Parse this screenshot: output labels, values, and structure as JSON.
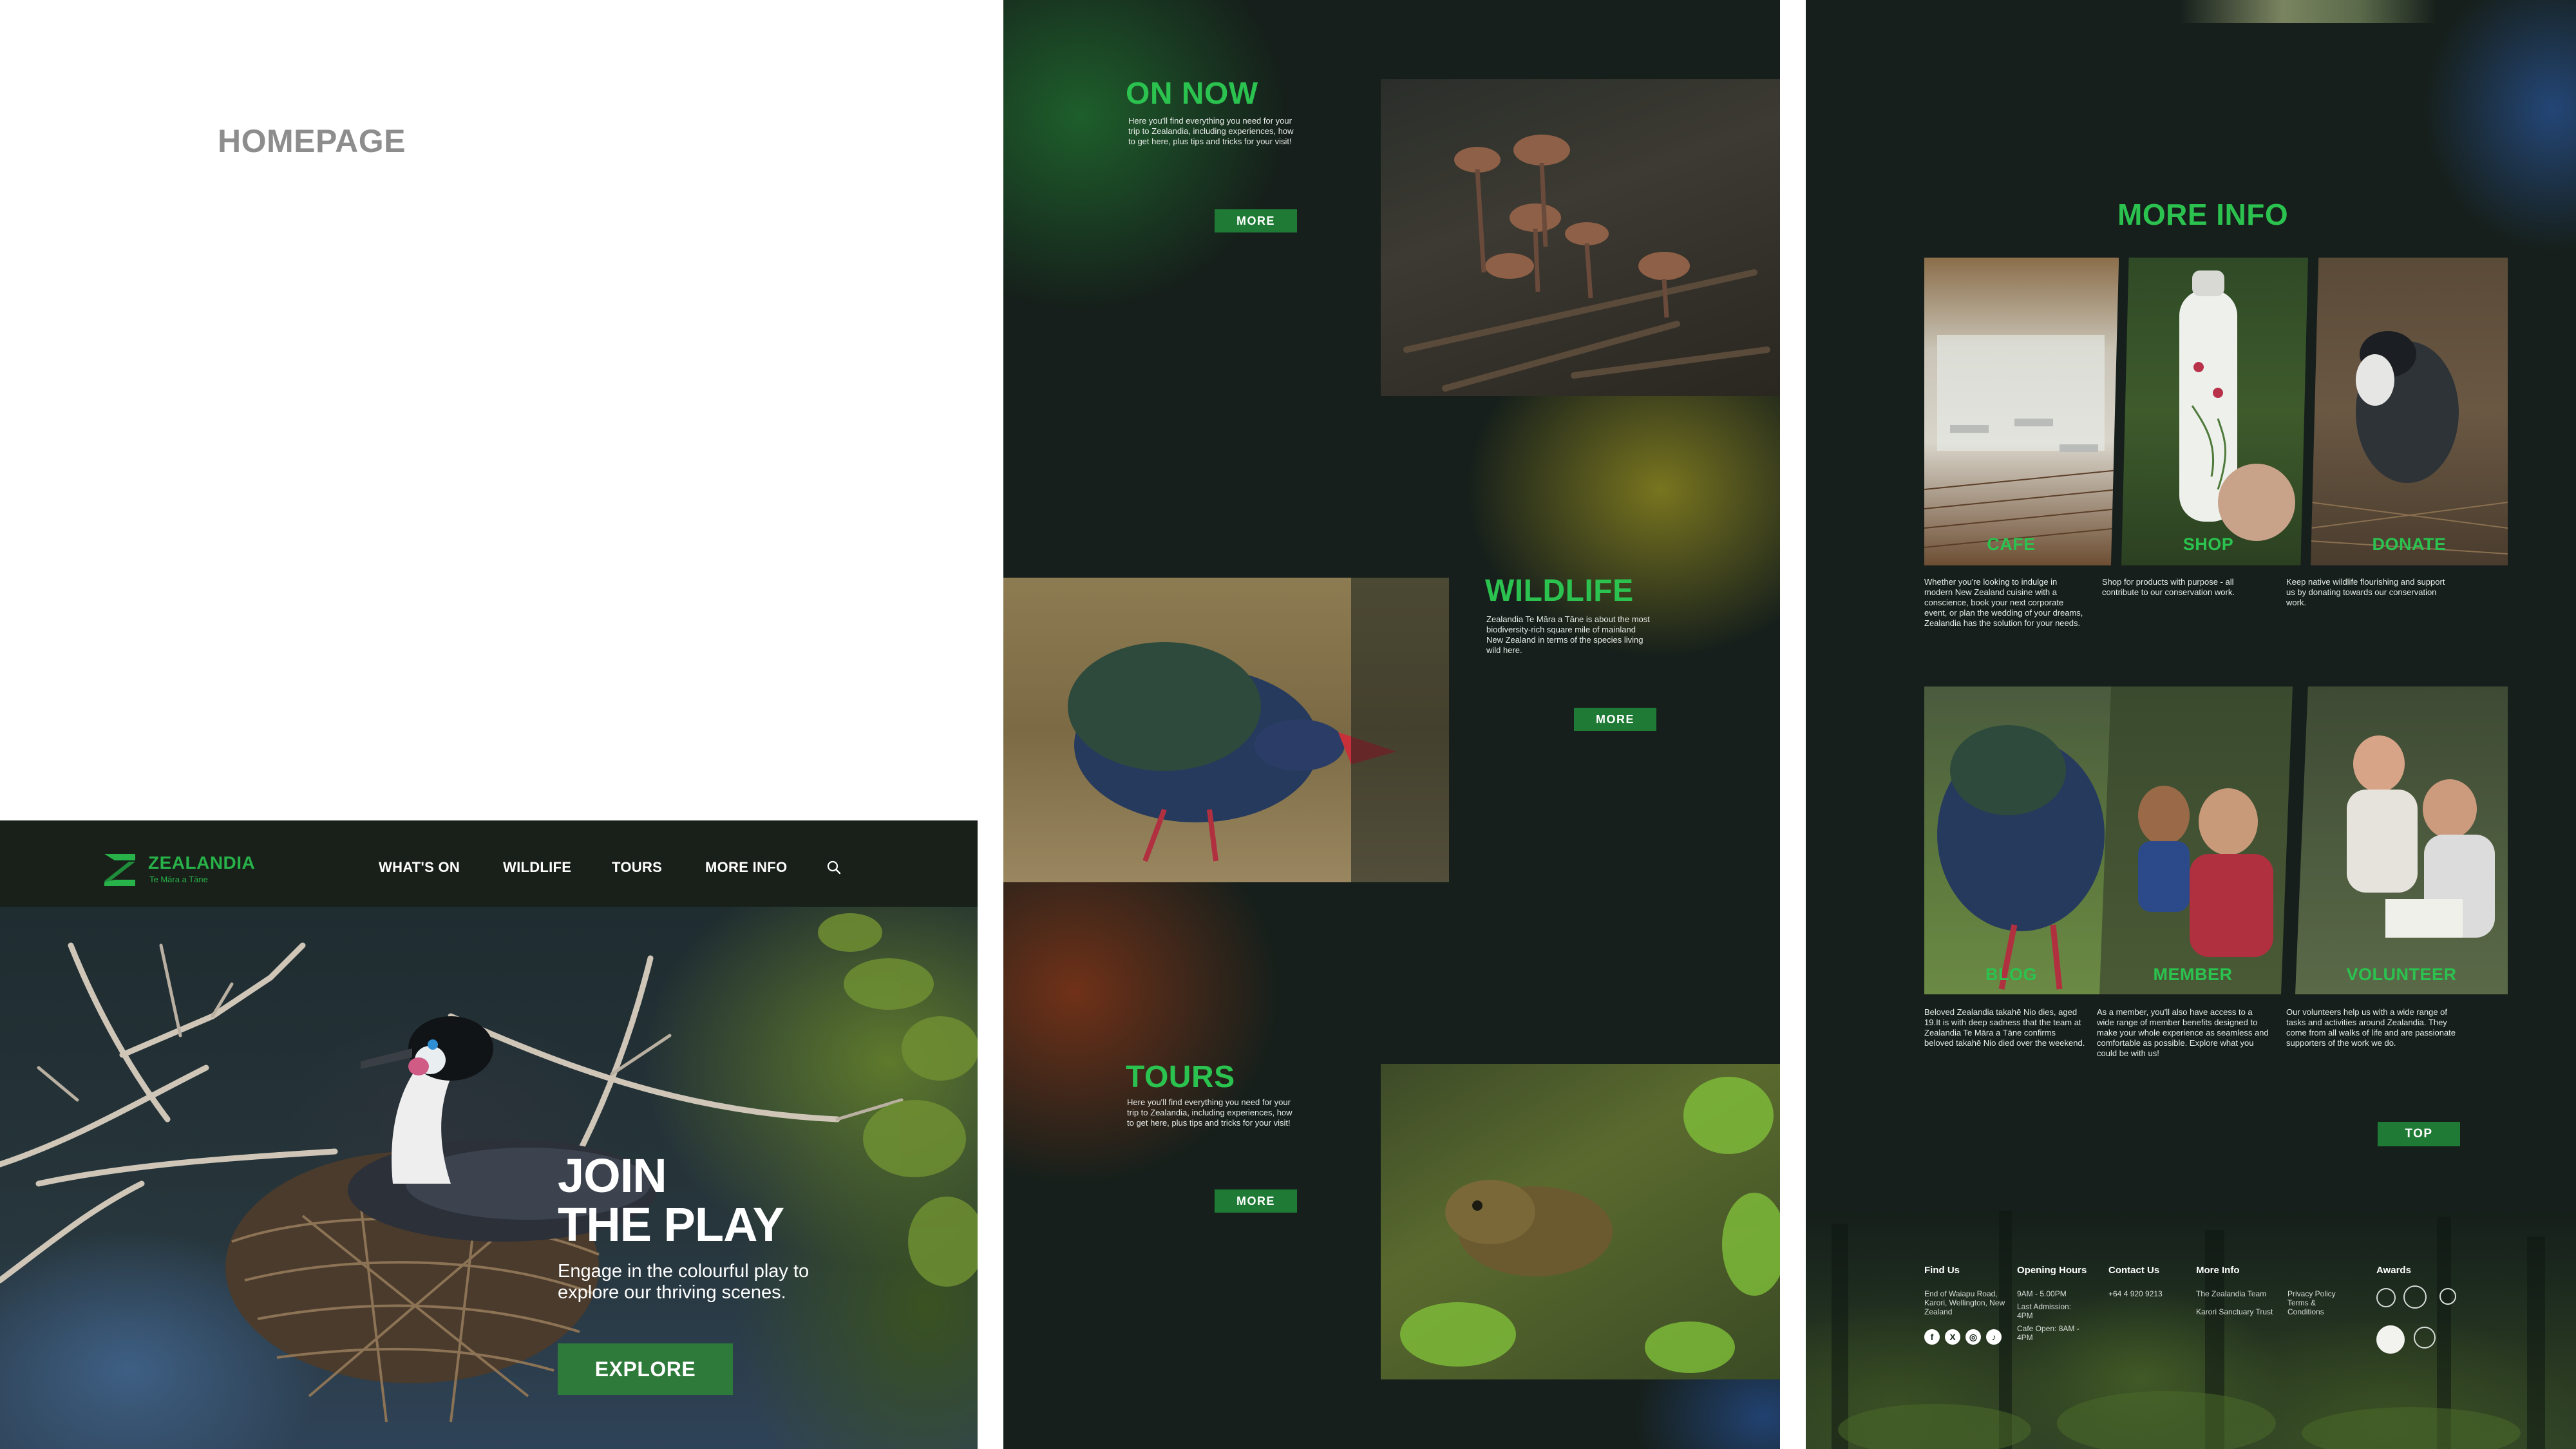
{
  "page_label": "HOMEPAGE",
  "brand": {
    "name": "ZEALANDIA",
    "tagline": "Te Māra a Tāne",
    "accent_color": "#2bc24f",
    "button_color": "#1e7a34",
    "background_color": "#161f1b"
  },
  "nav": {
    "items": [
      {
        "label": "WHAT'S ON"
      },
      {
        "label": "WILDLIFE"
      },
      {
        "label": "TOURS"
      },
      {
        "label": "MORE INFO"
      }
    ],
    "search_icon": "search-icon"
  },
  "hero": {
    "title_line1": "JOIN",
    "title_line2": "THE PLAY",
    "subtitle": "Engage in the colourful play to explore our thriving scenes.",
    "button_label": "EXPLORE"
  },
  "sections": {
    "on_now": {
      "title": "ON NOW",
      "description": "Here you'll find everything you need for your trip to Zealandia, including experiences, how to get here, plus tips and tricks for your visit!",
      "button_label": "MORE"
    },
    "wildlife": {
      "title": "WILDLIFE",
      "description": "Zealandia Te Māra a Tāne is about the most biodiversity-rich square mile of mainland New Zealand in terms of the species living wild here.",
      "button_label": "MORE"
    },
    "tours": {
      "title": "TOURS",
      "description": "Here you'll find everything you need for your trip to Zealandia, including experiences, how to get here, plus tips and tricks for your visit!",
      "button_label": "MORE"
    }
  },
  "more_info": {
    "title": "MORE INFO",
    "cards_row1": [
      {
        "label": "CAFE",
        "description": "Whether you're looking to indulge in modern New Zealand cuisine with a conscience, book your next corporate event, or plan the wedding of your dreams, Zealandia has the solution for your needs."
      },
      {
        "label": "SHOP",
        "description": "Shop for products with purpose - all contribute to our conservation work."
      },
      {
        "label": "DONATE",
        "description": "Keep native wildlife flourishing and support us by donating towards our conservation work."
      }
    ],
    "cards_row2": [
      {
        "label": "BLOG",
        "description": "Beloved Zealandia takahē Nio dies, aged 19.It is with deep sadness that the team at Zealandia Te Māra a Tāne confirms beloved takahē Nio died over the weekend."
      },
      {
        "label": "MEMBER",
        "description": "As a member, you'll also have access to a wide range of member benefits designed to make your whole experience as seamless and comfortable as possible. Explore what you could be with us!"
      },
      {
        "label": "VOLUNTEER",
        "description": "Our volunteers help us with a wide range of tasks and activities around Zealandia. They come from all walks of life and are passionate supporters of the work we do."
      }
    ],
    "top_button": "TOP"
  },
  "footer": {
    "find_us": {
      "heading": "Find Us",
      "address": "End of Waiapu Road, Karori, Wellington, New Zealand"
    },
    "hours": {
      "heading": "Opening Hours",
      "lines": [
        "9AM - 5.00PM",
        "Last Admission: 4PM",
        "Cafe Open: 8AM - 4PM"
      ]
    },
    "contact": {
      "heading": "Contact Us",
      "phone": "+64 4 920 9213"
    },
    "more_info": {
      "heading": "More Info",
      "lines": [
        "The Zealandia Team",
        "Karori Sanctuary Trust"
      ]
    },
    "legal": {
      "lines": [
        "Privacy Policy",
        "Terms & Conditions"
      ]
    },
    "awards": {
      "heading": "Awards"
    },
    "social_icons": [
      "facebook-icon",
      "x-icon",
      "instagram-icon",
      "tiktok-icon"
    ]
  }
}
